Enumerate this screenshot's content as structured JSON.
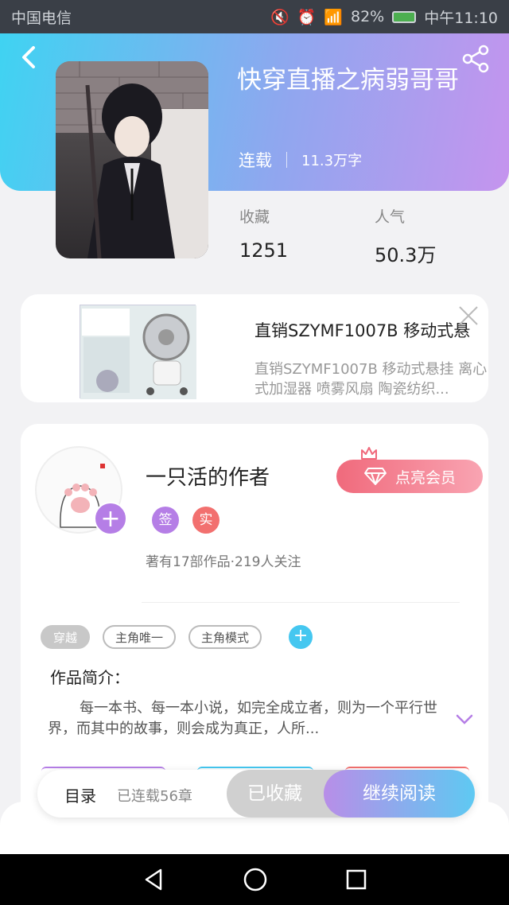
{
  "status_bar": {
    "carrier": "中国电信",
    "battery": "82%",
    "network": "2G",
    "time": "中午11:10"
  },
  "book": {
    "title": "快穿直播之病弱哥哥",
    "state": "连载",
    "words": "11.3万字",
    "fav_label": "收藏",
    "fav_value": "1251",
    "pop_label": "人气",
    "pop_value": "50.3万"
  },
  "ad": {
    "title": "直销SZYMF1007B 移动式悬",
    "desc": "直销SZYMF1007B 移动式悬挂 离心式加湿器 喷雾风扇 陶瓷纺织..."
  },
  "author": {
    "name": "一只活的作者",
    "badge_sign": "签",
    "badge_real": "实",
    "works": "著有17部作品·219人关注",
    "vip_label": "点亮会员"
  },
  "tags": [
    "穿越",
    "主角唯一",
    "主角模式"
  ],
  "intro": {
    "label": "作品简介：",
    "text": "每一本书、每一本小说，如完全成立者，则为一个平行世界，而其中的故事，则会成为真正，人所..."
  },
  "bottom_bar": {
    "toc": "目录",
    "chapters": "已连载56章",
    "fav": "已收藏",
    "read": "继续阅读"
  },
  "colors": {
    "hero_start": "#3fd3f2",
    "hero_end": "#c594ee",
    "vip": "#f06a7c",
    "accent": "#b57ee6"
  }
}
